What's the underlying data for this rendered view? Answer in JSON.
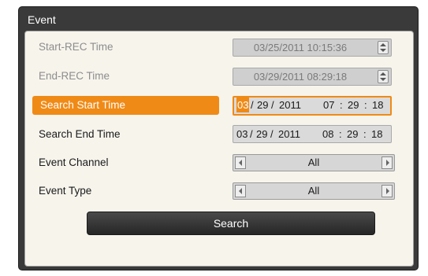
{
  "dialog": {
    "title": "Event"
  },
  "rows": {
    "start_rec": {
      "label": "Start-REC Time",
      "value": "03/25/2011 10:15:36"
    },
    "end_rec": {
      "label": "End-REC Time",
      "value": "03/29/2011 08:29:18"
    },
    "search_start": {
      "label": "Search Start Time",
      "month": "03",
      "sep1": "/",
      "day": "29",
      "sep2": "/",
      "year": "2011",
      "hour": "07",
      "colon1": ":",
      "minute": "29",
      "colon2": ":",
      "second": "18"
    },
    "search_end": {
      "label": "Search End Time",
      "month": "03",
      "sep1": "/",
      "day": "29",
      "sep2": "/",
      "year": "2011",
      "hour": "08",
      "colon1": ":",
      "minute": "29",
      "colon2": ":",
      "second": "18"
    },
    "event_channel": {
      "label": "Event Channel",
      "value": "All"
    },
    "event_type": {
      "label": "Event Type",
      "value": "All"
    }
  },
  "search_button": {
    "label": "Search"
  },
  "colors": {
    "accent": "#f08a16",
    "frame": "#3a3a3a",
    "panel": "#f7f4ec"
  }
}
